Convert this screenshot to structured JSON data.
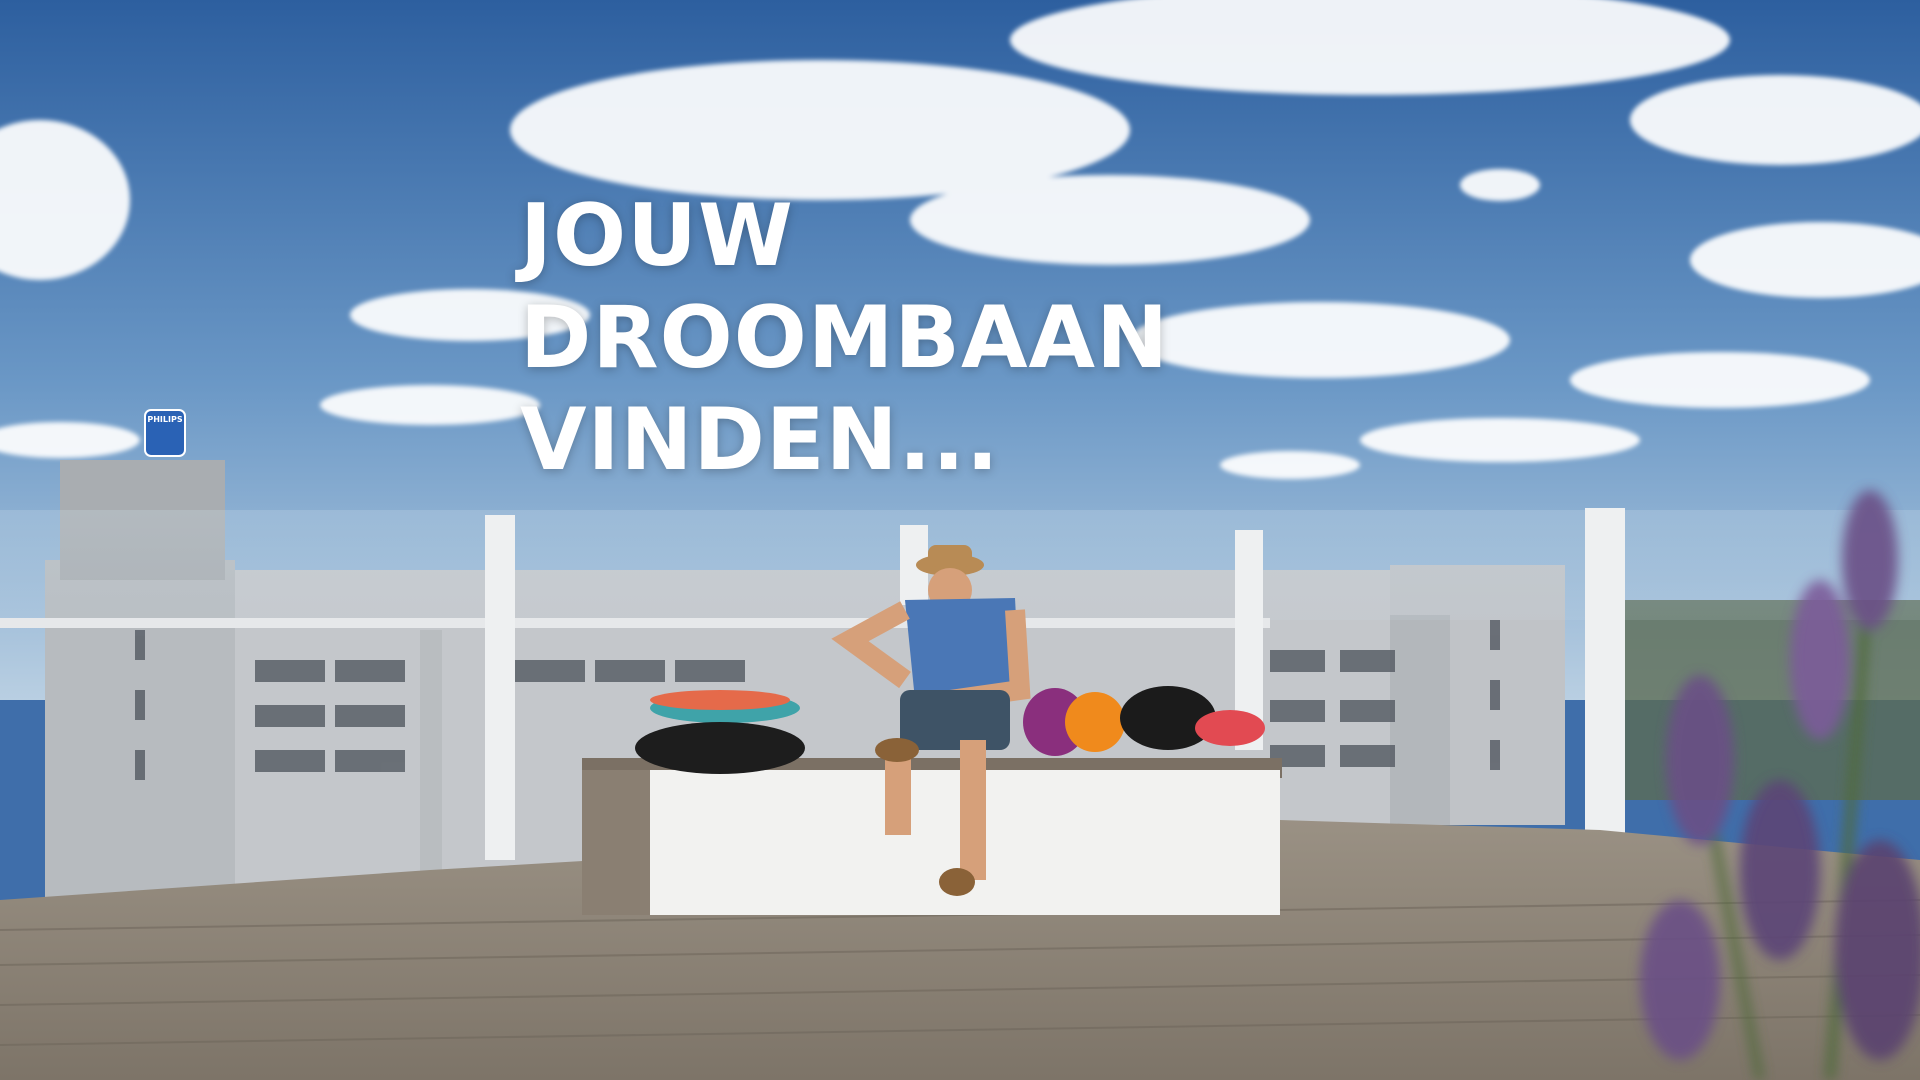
{
  "headline": {
    "line1": "JOUW",
    "line2": "DROOMBAAN",
    "line3": "VINDEN..."
  },
  "logo": {
    "text": "PHILIPS"
  },
  "colors": {
    "sky_top": "#2f63a6",
    "sky_bottom": "#b6cde2",
    "headline": "#ffffff",
    "deck": "#8d8478",
    "building": "#c9ccd0",
    "lavender": "#6a4f86"
  }
}
